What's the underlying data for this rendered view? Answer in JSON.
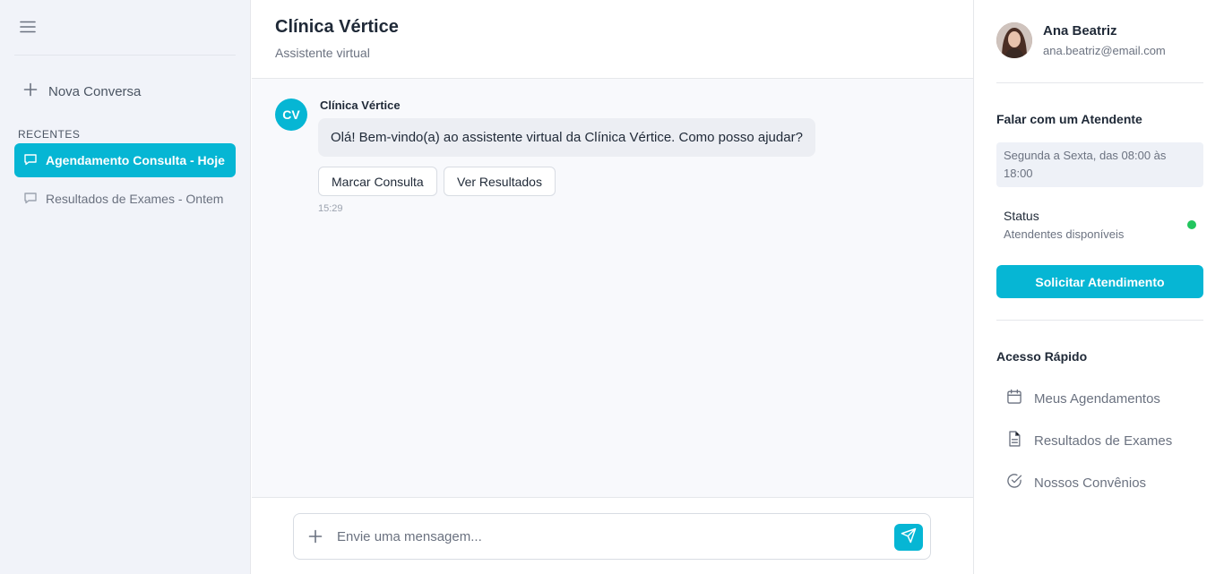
{
  "sidebar": {
    "new_chat_label": "Nova Conversa",
    "recents_label": "RECENTES",
    "conversations": [
      {
        "label": "Agendamento Consulta - Hoje"
      },
      {
        "label": "Resultados de Exames - Ontem"
      }
    ]
  },
  "header": {
    "title": "Clínica Vértice",
    "subtitle": "Assistente virtual"
  },
  "chat": {
    "avatar_initials": "CV",
    "sender": "Clínica Vértice",
    "message": "Olá! Bem-vindo(a) ao assistente virtual da Clínica Vértice. Como posso ajudar?",
    "quick_replies": [
      "Marcar Consulta",
      "Ver Resultados"
    ],
    "time": "15:29"
  },
  "composer": {
    "placeholder": "Envie uma mensagem...",
    "value": ""
  },
  "profile": {
    "name": "Ana Beatriz",
    "email": "ana.beatriz@email.com"
  },
  "support": {
    "title": "Falar com um Atendente",
    "hours": "Segunda a Sexta, das 08:00 às 18:00",
    "status_title": "Status",
    "status_desc": "Atendentes disponíveis",
    "status_color": "#22c55e",
    "button_label": "Solicitar Atendimento"
  },
  "quick_access": {
    "title": "Acesso Rápido",
    "links": [
      {
        "label": "Meus Agendamentos",
        "icon": "calendar-icon"
      },
      {
        "label": "Resultados de Exames",
        "icon": "document-icon"
      },
      {
        "label": "Nossos Convênios",
        "icon": "check-circle-icon"
      }
    ]
  },
  "colors": {
    "accent": "#06b6d4",
    "sidebar_bg": "#f1f3f9",
    "chat_bg": "#f8f9fc"
  }
}
